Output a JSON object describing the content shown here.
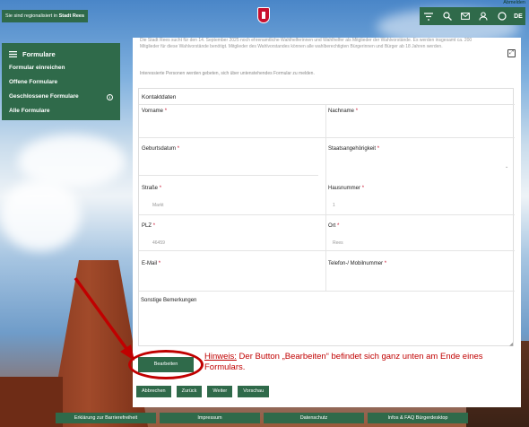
{
  "top": {
    "region_note_prefix": "Sie sind regionalisiert in",
    "region_note_city": "Stadt Rees",
    "logout": "Abmelden",
    "lang": "DE",
    "icons": [
      "filter-list-icon",
      "search-icon",
      "mail-icon",
      "user-icon",
      "circle-icon"
    ]
  },
  "sidebar": {
    "title": "Formulare",
    "items": [
      {
        "label": "Formular einreichen"
      },
      {
        "label": "Offene Formulare"
      },
      {
        "label": "Geschlossene Formulare",
        "badge": "i"
      },
      {
        "label": "Alle Formulare"
      }
    ]
  },
  "form": {
    "intro_line1": "Die Stadt Rees sucht für den 14. September 2025 noch ehrenamtliche Wahlhelferinnen und Wahlhelfer als Mitglieder der Wahlvorstände. Es werden insgesamt ca. 200",
    "intro_line2": "Mitglieder für diese Wahlvorstände benötigt. Mitglieder des Wahlvorstandes können alle wahlberechtigten Bürgerinnen und Bürger ab 18 Jahren werden.",
    "intro_cta": "Interessierte Personen werden gebeten, sich über untenstehendes Formular zu melden.",
    "section": "Kontaktdaten",
    "fields": {
      "vorname": {
        "label": "Vorname",
        "value": ""
      },
      "nachname": {
        "label": "Nachname",
        "value": ""
      },
      "geburtsdatum": {
        "label": "Geburtsdatum",
        "value": ""
      },
      "staat": {
        "label": "Staatsangehörigkeit",
        "value": ""
      },
      "strasse": {
        "label": "Straße",
        "value": "Markt"
      },
      "hausnummer": {
        "label": "Hausnummer",
        "value": "1"
      },
      "plz": {
        "label": "PLZ",
        "value": "46459"
      },
      "ort": {
        "label": "Ort",
        "value": "Rees"
      },
      "email": {
        "label": "E-Mail",
        "value": ""
      },
      "telefon": {
        "label": "Telefon-/ Mobilnummer",
        "value": ""
      }
    },
    "remarks_label": "Sonstige Bemerkungen",
    "required_mark": "*"
  },
  "actions": {
    "edit": "Bearbeiten",
    "cancel": "Abbrechen",
    "back": "Zurück",
    "next": "Weiter",
    "preview": "Vorschau"
  },
  "hint": {
    "label": "Hinweis:",
    "text": " Der Button „Bearbeiten“ befindet sich ganz unten am Ende eines Formulars."
  },
  "footer": {
    "links": [
      {
        "label": "Erklärung zur Barrierefreiheit"
      },
      {
        "label": "Impressum"
      },
      {
        "label": "Datenschutz"
      },
      {
        "label": "Infos & FAQ Bürgerdesktop"
      }
    ]
  },
  "colors": {
    "brand_green": "#2f6a4a",
    "annotation_red": "#c00000",
    "required_red": "#c8102e"
  }
}
